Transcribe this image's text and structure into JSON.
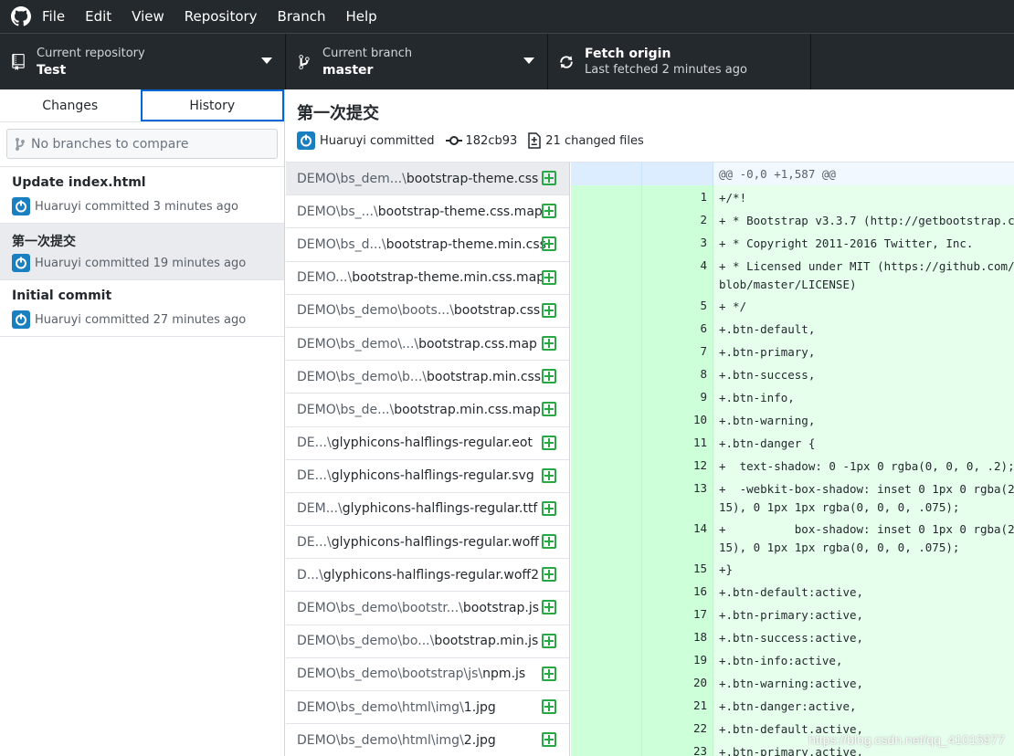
{
  "menu": {
    "items": [
      {
        "label": "File",
        "accel": "F"
      },
      {
        "label": "Edit",
        "accel": "E"
      },
      {
        "label": "View",
        "accel": "V"
      },
      {
        "label": "Repository",
        "accel": "R"
      },
      {
        "label": "Branch",
        "accel": "B"
      },
      {
        "label": "Help",
        "accel": "H"
      }
    ]
  },
  "toolbar": {
    "repo_label": "Current repository",
    "repo_value": "Test",
    "branch_label": "Current branch",
    "branch_value": "master",
    "fetch_label": "Fetch origin",
    "fetch_sub": "Last fetched 2 minutes ago"
  },
  "sidebar": {
    "tabs": [
      "Changes",
      "History"
    ],
    "active_tab": "History",
    "compare_placeholder": "No branches to compare",
    "commits": [
      {
        "title": "Update index.html",
        "meta": "Huaruyi committed 3 minutes ago"
      },
      {
        "title": "第一次提交",
        "meta": "Huaruyi committed 19 minutes ago"
      },
      {
        "title": "Initial commit",
        "meta": "Huaruyi committed 27 minutes ago"
      }
    ]
  },
  "commit": {
    "title": "第一次提交",
    "author": "Huaruyi committed",
    "sha": "182cb93",
    "changed": "21 changed files"
  },
  "files": [
    {
      "dir": "DEMO\\bs_dem...\\",
      "name": "bootstrap-theme.css"
    },
    {
      "dir": "DEMO\\bs_...\\",
      "name": "bootstrap-theme.css.map"
    },
    {
      "dir": "DEMO\\bs_d...\\",
      "name": "bootstrap-theme.min.css"
    },
    {
      "dir": "DEMO...\\",
      "name": "bootstrap-theme.min.css.map"
    },
    {
      "dir": "DEMO\\bs_demo\\boots...\\",
      "name": "bootstrap.css"
    },
    {
      "dir": "DEMO\\bs_demo\\...\\",
      "name": "bootstrap.css.map"
    },
    {
      "dir": "DEMO\\bs_demo\\b...\\",
      "name": "bootstrap.min.css"
    },
    {
      "dir": "DEMO\\bs_de...\\",
      "name": "bootstrap.min.css.map"
    },
    {
      "dir": "DE...\\",
      "name": "glyphicons-halflings-regular.eot"
    },
    {
      "dir": "DE...\\",
      "name": "glyphicons-halflings-regular.svg"
    },
    {
      "dir": "DEM...\\",
      "name": "glyphicons-halflings-regular.ttf"
    },
    {
      "dir": "DE...\\",
      "name": "glyphicons-halflings-regular.woff"
    },
    {
      "dir": "D...\\",
      "name": "glyphicons-halflings-regular.woff2"
    },
    {
      "dir": "DEMO\\bs_demo\\bootstr...\\",
      "name": "bootstrap.js"
    },
    {
      "dir": "DEMO\\bs_demo\\bo...\\",
      "name": "bootstrap.min.js"
    },
    {
      "dir": "DEMO\\bs_demo\\bootstrap\\js\\",
      "name": "npm.js"
    },
    {
      "dir": "DEMO\\bs_demo\\html\\img\\",
      "name": "1.jpg"
    },
    {
      "dir": "DEMO\\bs_demo\\html\\img\\",
      "name": "2.jpg"
    }
  ],
  "diff": {
    "hunk": "@@ -0,0 +1,587 @@",
    "lines": [
      {
        "n": "1",
        "text": "+/*!"
      },
      {
        "n": "2",
        "text": "+ * Bootstrap v3.3.7 (http://getbootstrap.c"
      },
      {
        "n": "3",
        "text": "+ * Copyright 2011-2016 Twitter, Inc."
      },
      {
        "n": "4",
        "text": "+ * Licensed under MIT (https://github.com/\nblob/master/LICENSE)"
      },
      {
        "n": "5",
        "text": "+ */"
      },
      {
        "n": "6",
        "text": "+.btn-default,"
      },
      {
        "n": "7",
        "text": "+.btn-primary,"
      },
      {
        "n": "8",
        "text": "+.btn-success,"
      },
      {
        "n": "9",
        "text": "+.btn-info,"
      },
      {
        "n": "10",
        "text": "+.btn-warning,"
      },
      {
        "n": "11",
        "text": "+.btn-danger {"
      },
      {
        "n": "12",
        "text": "+  text-shadow: 0 -1px 0 rgba(0, 0, 0, .2);"
      },
      {
        "n": "13",
        "text": "+  -webkit-box-shadow: inset 0 1px 0 rgba(2\n15), 0 1px 1px rgba(0, 0, 0, .075);"
      },
      {
        "n": "14",
        "text": "+          box-shadow: inset 0 1px 0 rgba(2\n15), 0 1px 1px rgba(0, 0, 0, .075);"
      },
      {
        "n": "15",
        "text": "+}"
      },
      {
        "n": "16",
        "text": "+.btn-default:active,"
      },
      {
        "n": "17",
        "text": "+.btn-primary:active,"
      },
      {
        "n": "18",
        "text": "+.btn-success:active,"
      },
      {
        "n": "19",
        "text": "+.btn-info:active,"
      },
      {
        "n": "20",
        "text": "+.btn-warning:active,"
      },
      {
        "n": "21",
        "text": "+.btn-danger:active,"
      },
      {
        "n": "22",
        "text": "+.btn-default.active,"
      },
      {
        "n": "23",
        "text": "+.btn-primary.active,"
      }
    ]
  },
  "watermark": "https://blog.csdn.net/qq_41015977",
  "colors": {
    "toolbar_bg": "#24292e",
    "accent": "#0366d6",
    "added": "#28a745",
    "diff_bg": "#e6ffed"
  }
}
